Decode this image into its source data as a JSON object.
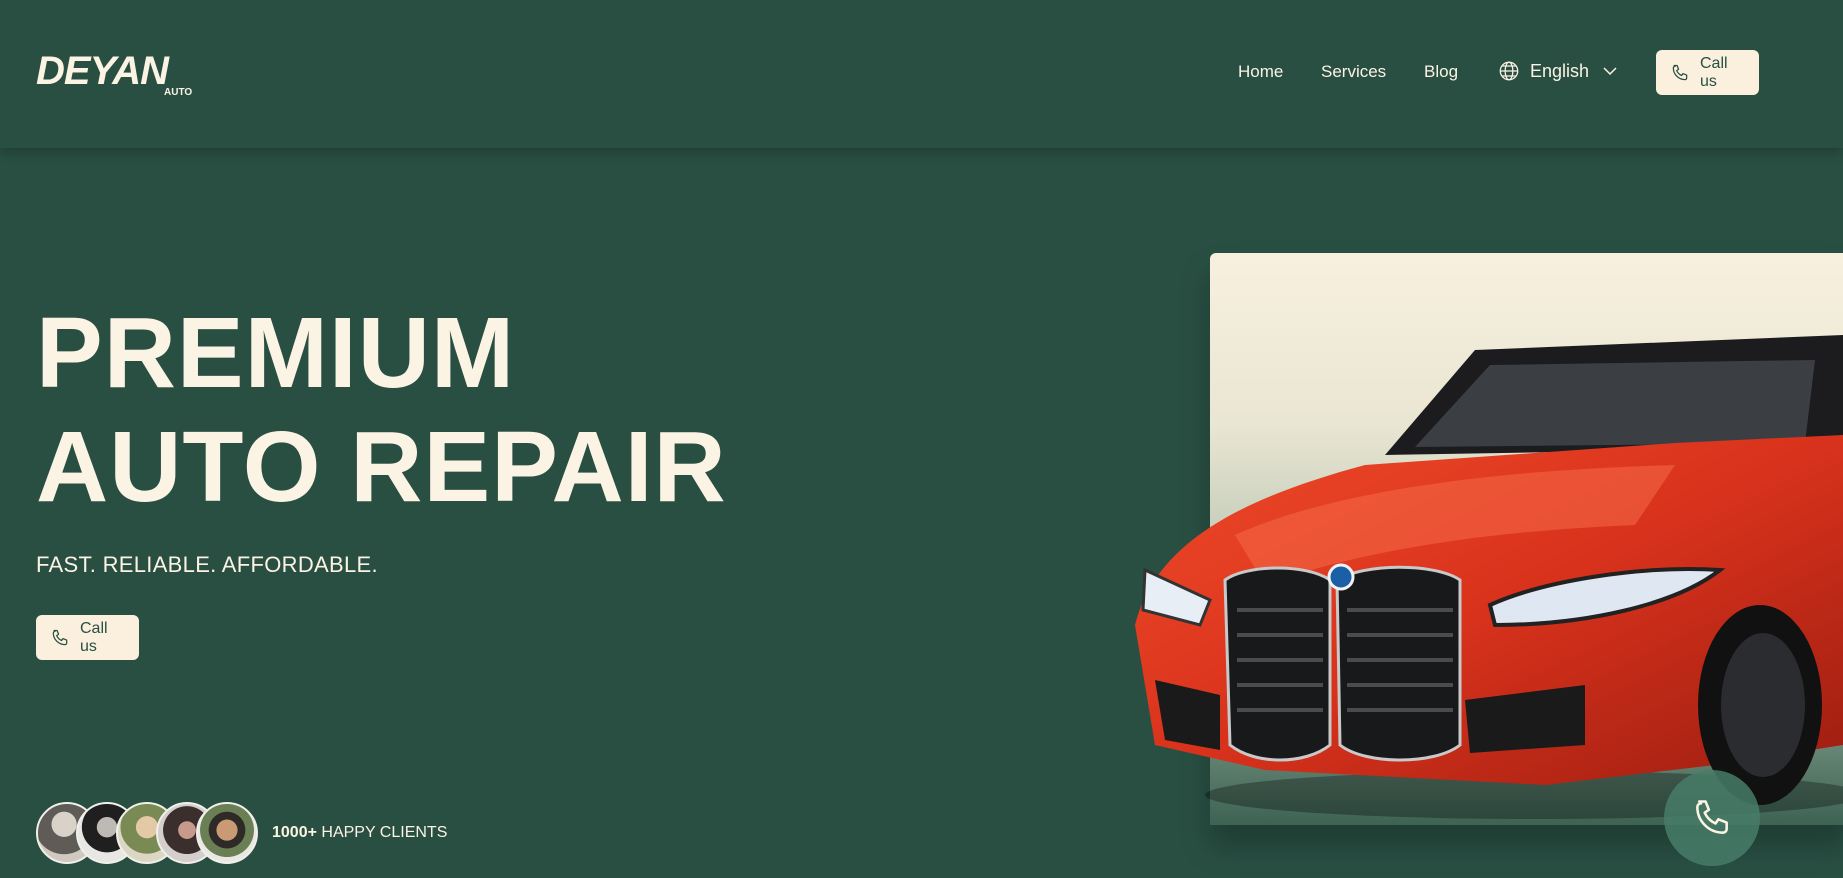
{
  "brand": {
    "logo_text": "DEYAN",
    "logo_sub": "AUTO"
  },
  "nav": {
    "items": [
      {
        "label": "Home"
      },
      {
        "label": "Services"
      },
      {
        "label": "Blog"
      }
    ],
    "language": "English",
    "call_button": "Call us"
  },
  "hero": {
    "title_line1": "PREMIUM",
    "title_line2": "AUTO REPAIR",
    "tagline": "FAST. RELIABLE. AFFORDABLE.",
    "call_button": "Call us",
    "clients_count": "1000+",
    "clients_label": "HAPPY CLIENTS"
  },
  "colors": {
    "background": "#294f43",
    "cream": "#fbf0dd",
    "car_red": "#d8321c"
  },
  "icons": [
    "globe-icon",
    "chevron-down-icon",
    "phone-icon"
  ]
}
